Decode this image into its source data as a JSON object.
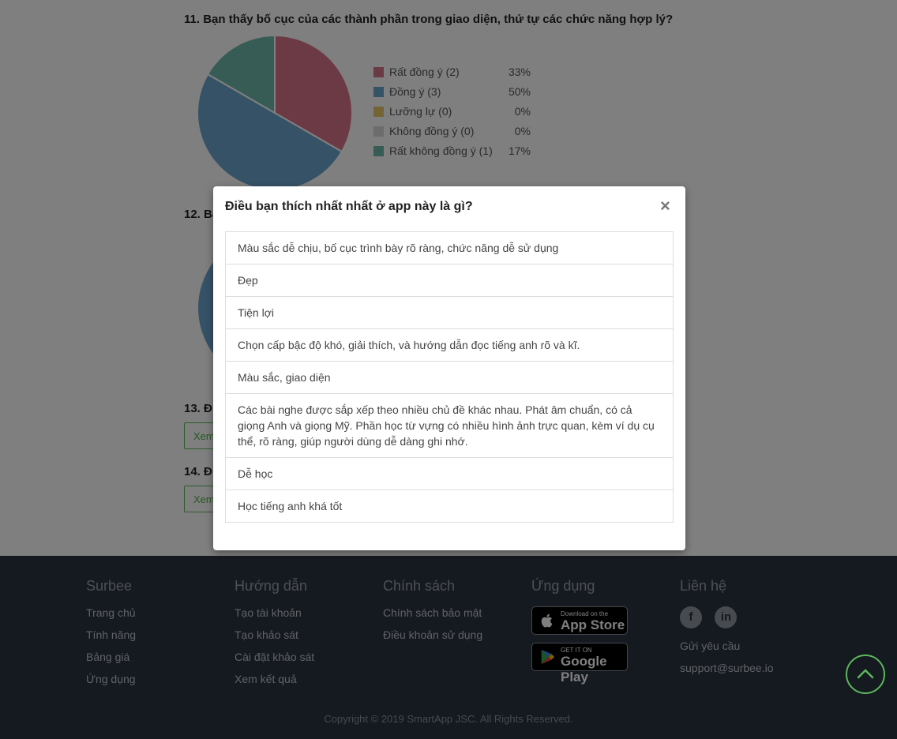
{
  "questions": [
    {
      "title": "11. Bạn thấy bố cục của các thành phần trong giao diện, thứ tự các chức năng hợp lý?"
    },
    {
      "title": "12. Bạ"
    },
    {
      "title": "13. Đ"
    },
    {
      "title": "14. Đ"
    }
  ],
  "view_button_label": "Xem",
  "chart_data": {
    "type": "pie",
    "title": "11. Bạn thấy bố cục của các thành phần trong giao diện, thứ tự các chức năng hợp lý?",
    "categories": [
      "Rất đồng ý (2)",
      "Đồng ý (3)",
      "Lưỡng lự (0)",
      "Không đồng ý (0)",
      "Rất không đồng ý (1)"
    ],
    "values": [
      2,
      3,
      0,
      0,
      1
    ],
    "percent_labels": [
      "33%",
      "50%",
      "0%",
      "0%",
      "17%"
    ],
    "colors": [
      "#d8748a",
      "#6da5cf",
      "#e8c86a",
      "#d9d9d9",
      "#6fb8ad"
    ],
    "legend": "right"
  },
  "modal": {
    "title": "Điều bạn thích nhất nhất ở app này là gì?",
    "close_symbol": "×",
    "answers": [
      "Màu sắc dễ chịu, bố cục trình bày rõ ràng, chức năng dễ sử dụng",
      "Đẹp",
      "Tiện lợi",
      "Chọn cấp bậc độ khó, giải thích, và hướng dẫn đọc tiếng anh rõ và kĩ.",
      "Màu sắc, giao diện",
      "Các bài nghe được sắp xếp theo nhiều chủ đề khác nhau. Phát âm chuẩn, có cả giọng Anh và giọng Mỹ. Phần học từ vựng có nhiều hình ảnh trực quan, kèm ví dụ cụ thể, rõ ràng, giúp người dùng dễ dàng ghi nhớ.",
      "Dễ học",
      "Học tiếng anh khá tốt"
    ]
  },
  "footer": {
    "col1": {
      "heading": "Surbee",
      "links": [
        "Trang chủ",
        "Tính năng",
        "Bảng giá",
        "Ứng dụng"
      ]
    },
    "col2": {
      "heading": "Hướng dẫn",
      "links": [
        "Tạo tài khoản",
        "Tạo khảo sát",
        "Cài đặt khảo sát",
        "Xem kết quả"
      ]
    },
    "col3": {
      "heading": "Chính sách",
      "links": [
        "Chính sách bảo mật",
        "Điều khoản sử dụng"
      ]
    },
    "col4": {
      "heading": "Ứng dụng",
      "appstore": {
        "small": "Download on the",
        "big": "App Store",
        "icon": "apple-icon"
      },
      "googleplay": {
        "small": "GET IT ON",
        "big": "Google Play",
        "icon": "play-icon"
      }
    },
    "col5": {
      "heading": "Liên hệ",
      "facebook": "f",
      "linkedin": "in",
      "request_link": "Gửi yêu cầu",
      "email": "support@surbee.io"
    },
    "copyright": "Copyright © 2019 SmartApp JSC. All Rights Reserved.",
    "accent_color": "#5cb85c",
    "background_color": "#2a3340"
  }
}
